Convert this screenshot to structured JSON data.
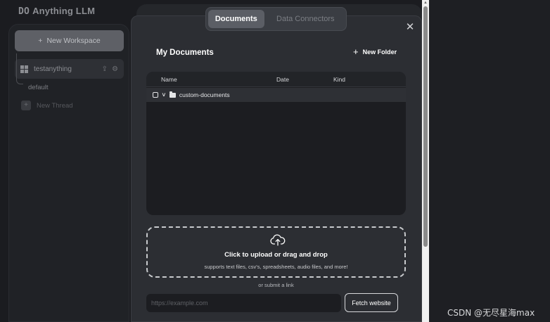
{
  "app": {
    "logo_text": "Anything LLM",
    "logo_mark": "DO"
  },
  "sidebar": {
    "new_workspace_label": "New Workspace",
    "workspace_name": "testanything",
    "thread_default": "default",
    "new_thread_label": "New Thread"
  },
  "modal": {
    "tabs": [
      {
        "label": "Documents",
        "active": true
      },
      {
        "label": "Data Connectors",
        "active": false
      }
    ],
    "title": "My Documents",
    "new_folder_label": "New Folder",
    "table": {
      "columns": [
        "Name",
        "Date",
        "Kind"
      ],
      "rows": [
        {
          "name": "custom-documents",
          "date": "",
          "kind": ""
        }
      ]
    },
    "upload": {
      "title": "Click to upload or drag and drop",
      "subtitle": "supports text files, csv's, spreadsheets, audio files, and more!"
    },
    "or_submit_link": "or submit a link",
    "url_placeholder": "https://example.com",
    "url_value": "",
    "fetch_button": "Fetch website"
  },
  "watermark": "CSDN @无尽星海max",
  "icons": {
    "close": "close-icon",
    "plus": "plus-icon",
    "folder": "folder-icon",
    "chevron": "chevron-down-icon",
    "upload": "cloud-upload-icon",
    "workspace": "grid-icon"
  },
  "colors": {
    "modal_bg": "#2c2e33",
    "table_bg": "#1c1d21",
    "active_tab": "#5b5e65"
  }
}
